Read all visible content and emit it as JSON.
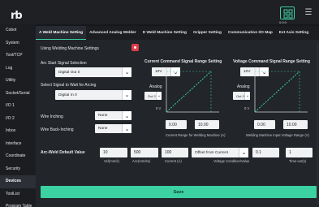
{
  "app": {
    "logo": "rb",
    "top_icons": [
      {
        "name": "status-icon",
        "label": "0:0:0"
      },
      {
        "name": "more-icon",
        "label": "☰"
      }
    ]
  },
  "sidebar": {
    "items": [
      {
        "label": "Cobot",
        "active": false
      },
      {
        "label": "System",
        "active": false
      },
      {
        "label": "Tool/TCP",
        "active": false
      },
      {
        "label": "Log",
        "active": false
      },
      {
        "label": "Utility",
        "active": false
      },
      {
        "label": "Socket/Serial",
        "active": false
      },
      {
        "label": "I/O 1",
        "active": false
      },
      {
        "label": "I/O 2",
        "active": false
      },
      {
        "label": "Inbox",
        "active": false
      },
      {
        "label": "Interface",
        "active": false
      },
      {
        "label": "Coordinate",
        "active": false
      },
      {
        "label": "Security",
        "active": false
      },
      {
        "label": "Devices",
        "active": true
      },
      {
        "label": "ToolList",
        "active": false
      },
      {
        "label": "Program Table",
        "active": false
      }
    ]
  },
  "tabs": [
    {
      "label": "A Weld Machine Setting",
      "active": true
    },
    {
      "label": "Advanced Analog Welder",
      "active": false
    },
    {
      "label": "D Weld Machine Setting",
      "active": false
    },
    {
      "label": "Gripper Setting",
      "active": false
    },
    {
      "label": "Communication I/O Map",
      "active": false
    },
    {
      "label": "Ext Axis Setting",
      "active": false
    }
  ],
  "form": {
    "use_weld_label": "Using Welding Machine Settings",
    "arc_start_label": "Arc Start Signal Selection",
    "arc_start_value": "Digital Out 0",
    "wait_arc_label": "Select Signal to Wait for Arcing",
    "wait_arc_value": "Digital In 0",
    "wire_inch_label": "Wire Inching",
    "wire_inch_value": "None",
    "wire_back_label": "Wire Back-Inching",
    "wire_back_value": "None",
    "arc_default_label": "Arc-Weld Default Value",
    "defaults": [
      {
        "value": "10",
        "caption": "Vel(mm/s)"
      },
      {
        "value": "500",
        "caption": "Acc(mm/ss)"
      },
      {
        "value": "100",
        "caption": "Current (A)"
      }
    ],
    "voltage_condition_value": "Offset from Current",
    "voltage_condition_caption": "Voltage Condition/Value",
    "voltage_value": "0.1",
    "time_value": "1",
    "time_caption": "Time-out(s)"
  },
  "current_graph": {
    "title": "Current Command Signal Range Setting",
    "volt_value": "10V",
    "analog_label": "Analog",
    "analog_value": "Out 2",
    "zero_label": "0 V",
    "min_value": "0.00",
    "max_value": "10.00",
    "caption": "Current Range for Welding Machine (A)"
  },
  "voltage_graph": {
    "title": "Voltage Command Signal Range Setting",
    "volt_value": "10V",
    "analog_label": "Analog",
    "analog_value": "Out 3",
    "zero_label": "0 V",
    "min_value": "0.00",
    "max_value": "10.00",
    "caption": "Welding Machine Input Voltage Range (V)"
  },
  "save_label": "Save",
  "colors": {
    "accent": "#3bd1a0",
    "toggle": "#e23b4b"
  }
}
